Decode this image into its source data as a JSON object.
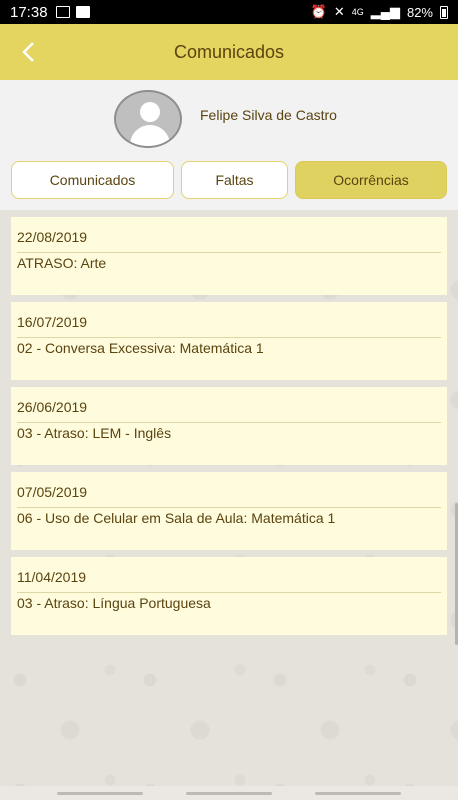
{
  "status_bar": {
    "time": "17:38",
    "network": "4G",
    "battery": "82%"
  },
  "header": {
    "title": "Comunicados"
  },
  "profile": {
    "name": "Felipe Silva de Castro"
  },
  "tabs": [
    {
      "label": "Comunicados",
      "active": false
    },
    {
      "label": "Faltas",
      "active": false
    },
    {
      "label": "Ocorrências",
      "active": true
    }
  ],
  "entries": [
    {
      "date": "22/08/2019",
      "description": "ATRASO: Arte"
    },
    {
      "date": "16/07/2019",
      "description": "02 - Conversa Excessiva: Matemática 1"
    },
    {
      "date": "26/06/2019",
      "description": "03 - Atraso: LEM - Inglês"
    },
    {
      "date": "07/05/2019",
      "description": "06 - Uso de Celular em Sala de Aula: Matemática 1"
    },
    {
      "date": "11/04/2019",
      "description": "03 - Atraso: Língua Portuguesa"
    }
  ],
  "icons": {
    "back": "chevron-left-icon",
    "avatar": "user-avatar-icon"
  },
  "colors": {
    "primary": "#e4d460",
    "card": "#fffbdd",
    "text": "#5a4410"
  }
}
